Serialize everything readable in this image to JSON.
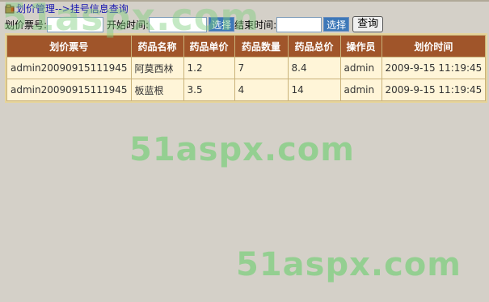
{
  "page": {
    "title_path": "划价管理-->挂号信息查询"
  },
  "search": {
    "ticket_label": "划价票号:",
    "ticket_value": "",
    "start_label": "开始时间:",
    "start_value": "",
    "end_label": "结束时间:",
    "end_value": "",
    "pick_label": "选择",
    "query_label": "查询"
  },
  "table": {
    "columns": [
      "划价票号",
      "药品名称",
      "药品单价",
      "药品数量",
      "药品总价",
      "操作员",
      "划价时间"
    ],
    "rows": [
      [
        "admin20090915111945",
        "阿莫西林",
        "1.2",
        "7",
        "8.4",
        "admin",
        "2009-9-15 11:19:45"
      ],
      [
        "admin20090915111945",
        "板蓝根",
        "3.5",
        "4",
        "14",
        "admin",
        "2009-9-15 11:19:45"
      ]
    ]
  },
  "watermark": {
    "text": "51aspx.com"
  },
  "colors": {
    "header_bg": "#a0552a",
    "row_bg": "#fff5d8",
    "title_link": "#1515b0",
    "watermark": "#7fcf7f"
  }
}
